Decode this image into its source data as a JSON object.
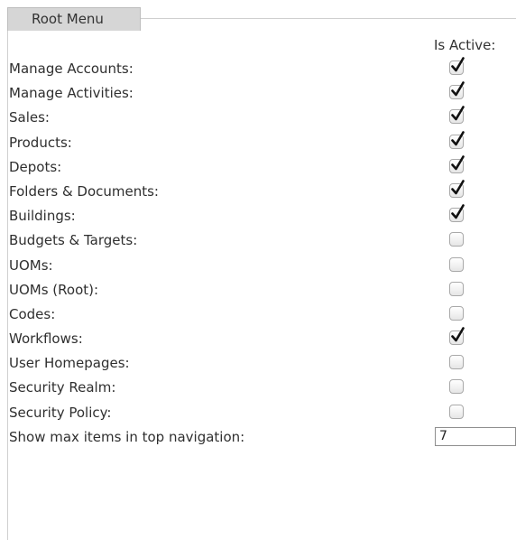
{
  "tab": {
    "label": "Root Menu"
  },
  "column_header": "Is Active:",
  "rows": [
    {
      "label": "Manage Accounts:",
      "checked": true
    },
    {
      "label": "Manage Activities:",
      "checked": true
    },
    {
      "label": "Sales:",
      "checked": true
    },
    {
      "label": "Products:",
      "checked": true
    },
    {
      "label": "Depots:",
      "checked": true
    },
    {
      "label": "Folders & Documents:",
      "checked": true
    },
    {
      "label": "Buildings:",
      "checked": true
    },
    {
      "label": "Budgets & Targets:",
      "checked": false
    },
    {
      "label": "UOMs:",
      "checked": false
    },
    {
      "label": "UOMs (Root):",
      "checked": false
    },
    {
      "label": "Codes:",
      "checked": false
    },
    {
      "label": "Workflows:",
      "checked": true
    },
    {
      "label": "User Homepages:",
      "checked": false
    },
    {
      "label": "Security Realm:",
      "checked": false
    },
    {
      "label": "Security Policy:",
      "checked": false
    }
  ],
  "max_items": {
    "label": "Show max items in top navigation:",
    "value": "7"
  },
  "icons": {
    "checkbox_checked": "checkmark-icon"
  }
}
